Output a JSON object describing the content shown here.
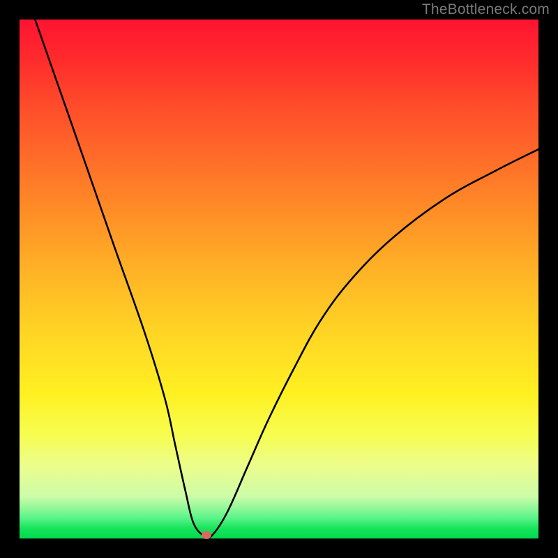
{
  "watermark": "TheBottleneck.com",
  "chart_data": {
    "type": "line",
    "title": "",
    "xlabel": "",
    "ylabel": "",
    "xlim": [
      0,
      100
    ],
    "ylim": [
      0,
      100
    ],
    "series": [
      {
        "name": "curve",
        "x": [
          3,
          10,
          18,
          24,
          28,
          30,
          32,
          33.5,
          35.5,
          37,
          40,
          44,
          48,
          53,
          58,
          64,
          72,
          82,
          92,
          100
        ],
        "values": [
          100,
          80,
          57,
          40,
          27,
          18,
          9,
          3,
          0.5,
          0.5,
          5,
          14,
          23,
          33,
          42,
          50,
          58,
          65.5,
          71,
          75
        ]
      }
    ],
    "marker": {
      "x": 36,
      "y": 0.7,
      "color": "#d66b5f"
    }
  }
}
